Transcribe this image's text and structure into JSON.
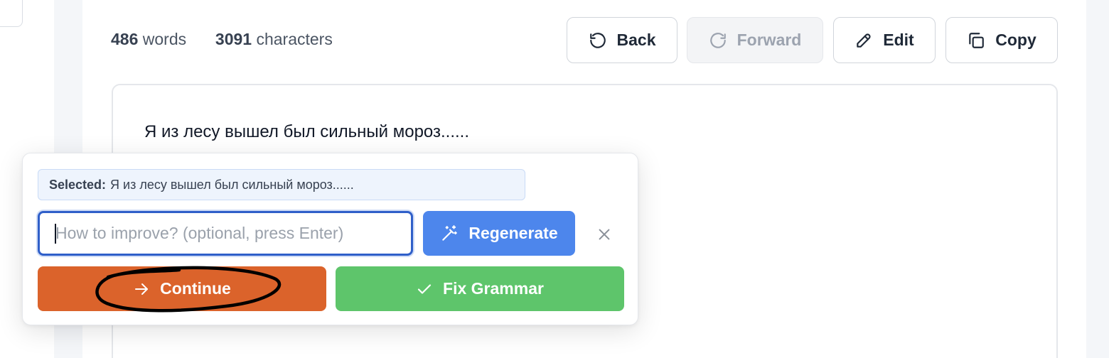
{
  "stats": {
    "words_count": "486",
    "words_label": "words",
    "chars_count": "3091",
    "chars_label": "characters"
  },
  "toolbar": {
    "back_label": "Back",
    "forward_label": "Forward",
    "edit_label": "Edit",
    "copy_label": "Copy",
    "back_icon": "undo-icon",
    "forward_icon": "redo-icon",
    "edit_icon": "pencil-icon",
    "copy_icon": "copy-icon",
    "forward_disabled": true
  },
  "editor": {
    "text": "Я из лесу вышел был сильный мороз......"
  },
  "popover": {
    "selected_label": "Selected:",
    "selected_text": "Я из лесу вышел был сильный мороз......",
    "input_value": "",
    "input_placeholder": "How to improve? (optional, press Enter)",
    "regenerate_label": "Regenerate",
    "regenerate_icon": "magic-wand-icon",
    "close_icon": "close-icon",
    "continue_label": "Continue",
    "continue_icon": "arrow-right-icon",
    "fix_grammar_label": "Fix Grammar",
    "fix_grammar_icon": "check-icon"
  },
  "colors": {
    "continue_bg": "#db632b",
    "fix_grammar_bg": "#5ec56b",
    "regenerate_bg": "#4d86ec",
    "input_focus_border": "#2f5fc9",
    "selected_chip_bg": "#eef4fd",
    "annotation_stroke": "#000000"
  }
}
